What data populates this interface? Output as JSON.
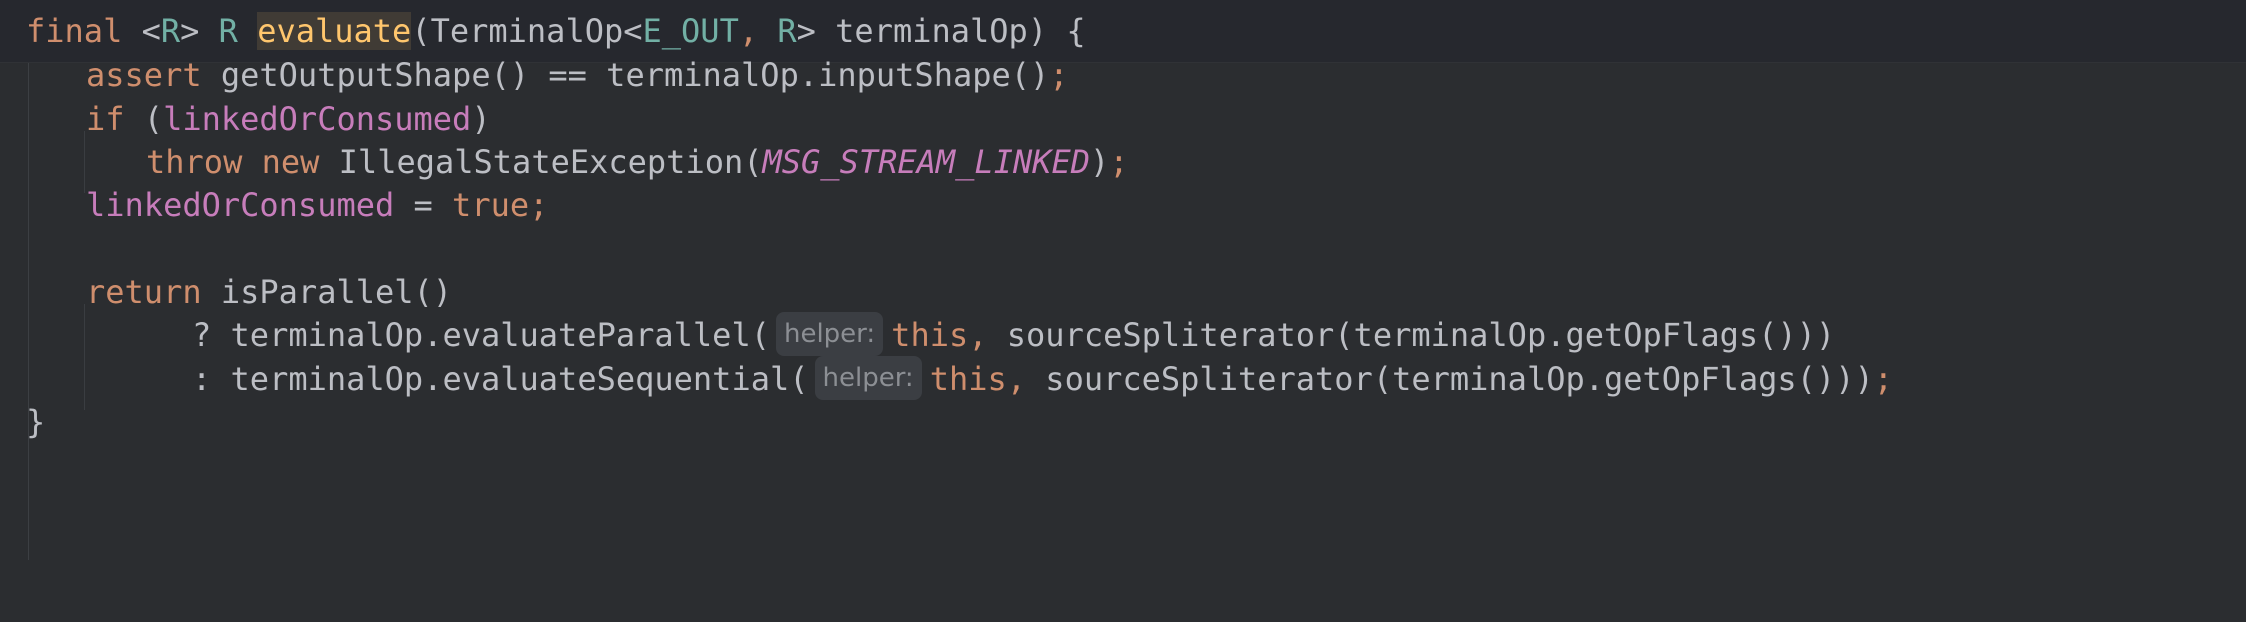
{
  "editor": {
    "lines": [
      {
        "id": "line-1",
        "tokens": [
          {
            "t": "final",
            "c": "kw"
          },
          {
            "t": " <",
            "c": "plain"
          },
          {
            "t": "R",
            "c": "tp"
          },
          {
            "t": "> ",
            "c": "plain"
          },
          {
            "t": "R",
            "c": "tp"
          },
          {
            "t": " ",
            "c": "plain"
          },
          {
            "t": "evaluate",
            "c": "decl"
          },
          {
            "t": "(TerminalOp<",
            "c": "plain"
          },
          {
            "t": "E_OUT",
            "c": "tp"
          },
          {
            "t": ", ",
            "c": "punct"
          },
          {
            "t": "R",
            "c": "tp"
          },
          {
            "t": "> terminalOp) {",
            "c": "plain"
          }
        ]
      },
      {
        "id": "line-2",
        "tokens": [
          {
            "t": "assert",
            "c": "kw"
          },
          {
            "t": " getOutputShape() == terminalOp.inputShape()",
            "c": "plain"
          },
          {
            "t": ";",
            "c": "punct"
          }
        ]
      },
      {
        "id": "line-3",
        "tokens": [
          {
            "t": "if",
            "c": "kw"
          },
          {
            "t": " (",
            "c": "plain"
          },
          {
            "t": "linkedOrConsumed",
            "c": "field"
          },
          {
            "t": ")",
            "c": "plain"
          }
        ]
      },
      {
        "id": "line-4",
        "tokens": [
          {
            "t": "throw new",
            "c": "kw"
          },
          {
            "t": " IllegalStateException(",
            "c": "plain"
          },
          {
            "t": "MSG_STREAM_LINKED",
            "c": "const"
          },
          {
            "t": ")",
            "c": "plain"
          },
          {
            "t": ";",
            "c": "punct"
          }
        ]
      },
      {
        "id": "line-5",
        "tokens": [
          {
            "t": "linkedOrConsumed",
            "c": "field"
          },
          {
            "t": " = ",
            "c": "plain"
          },
          {
            "t": "true",
            "c": "kw"
          },
          {
            "t": ";",
            "c": "punct"
          }
        ]
      },
      {
        "id": "line-6",
        "tokens": []
      },
      {
        "id": "line-7",
        "tokens": [
          {
            "t": "return",
            "c": "kw"
          },
          {
            "t": " isParallel()",
            "c": "plain"
          }
        ]
      },
      {
        "id": "line-8",
        "tokens": [
          {
            "t": "? terminalOp.evaluateParallel(",
            "c": "plain"
          },
          {
            "t": "helper:",
            "c": "hint"
          },
          {
            "t": "this",
            "c": "kw"
          },
          {
            "t": ", ",
            "c": "punct"
          },
          {
            "t": "sourceSpliterator(terminalOp.getOpFlags()))",
            "c": "plain"
          }
        ]
      },
      {
        "id": "line-9",
        "tokens": [
          {
            "t": ": terminalOp.evaluateSequential(",
            "c": "plain"
          },
          {
            "t": "helper:",
            "c": "hint"
          },
          {
            "t": "this",
            "c": "kw"
          },
          {
            "t": ", ",
            "c": "punct"
          },
          {
            "t": "sourceSpliterator(terminalOp.getOpFlags()))",
            "c": "plain"
          },
          {
            "t": ";",
            "c": "punct"
          }
        ]
      },
      {
        "id": "line-10",
        "tokens": [
          {
            "t": "}",
            "c": "plain"
          }
        ]
      }
    ],
    "colors": {
      "background": "#2b2d30",
      "keyword": "#cf8e6d",
      "field": "#c77dbb",
      "type_param": "#72b0a5",
      "declaration": "#ffc66d",
      "text": "#bcbec4",
      "hint_bg": "#3b3e43",
      "hint_text": "#8c8f94"
    }
  }
}
